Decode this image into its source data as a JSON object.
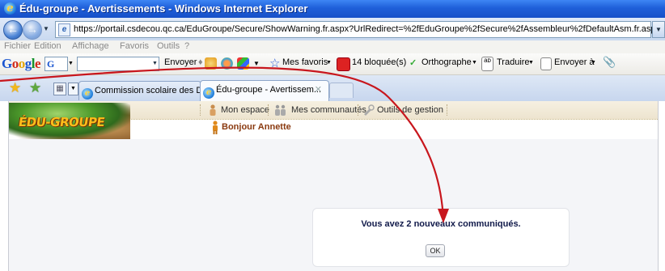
{
  "window": {
    "title": "Édu-groupe - Avertissements - Windows Internet Explorer"
  },
  "address_bar": {
    "url": "https://portail.csdecou.qc.ca/EduGroupe/Secure/ShowWarning.fr.aspx?UrlRedirect=%2fEduGroupe%2fSecure%2fAssembleur%2fDefaultAsm.fr.aspx"
  },
  "menu": {
    "items": [
      "Fichier",
      "Edition",
      "Affichage",
      "Favoris",
      "Outils",
      "?"
    ]
  },
  "google_toolbar": {
    "send_label": "Envoyer",
    "favorites_label": "Mes favoris",
    "blocked_label": "14 bloquée(s)",
    "spelling_label": "Orthographe",
    "translate_label": "Traduire",
    "send_to_label": "Envoyer à"
  },
  "tabs": [
    {
      "label": "Commission scolaire des Déc...",
      "active": false
    },
    {
      "label": "Édu-groupe - Avertissem...",
      "active": true
    }
  ],
  "site": {
    "logo_text": "ÉDU-GROUPE",
    "nav": {
      "my_space": "Mon espace",
      "my_communities": "Mes communautés",
      "management_tools": "Outils de gestion"
    },
    "greeting": "Bonjour Annette"
  },
  "dialog": {
    "message": "Vous avez 2 nouveaux communiqués.",
    "ok_label": "OK"
  },
  "colors": {
    "title_bar": "#1f5fd9",
    "annotation_arrow": "#c8161d",
    "greeting": "#8a3a10"
  }
}
